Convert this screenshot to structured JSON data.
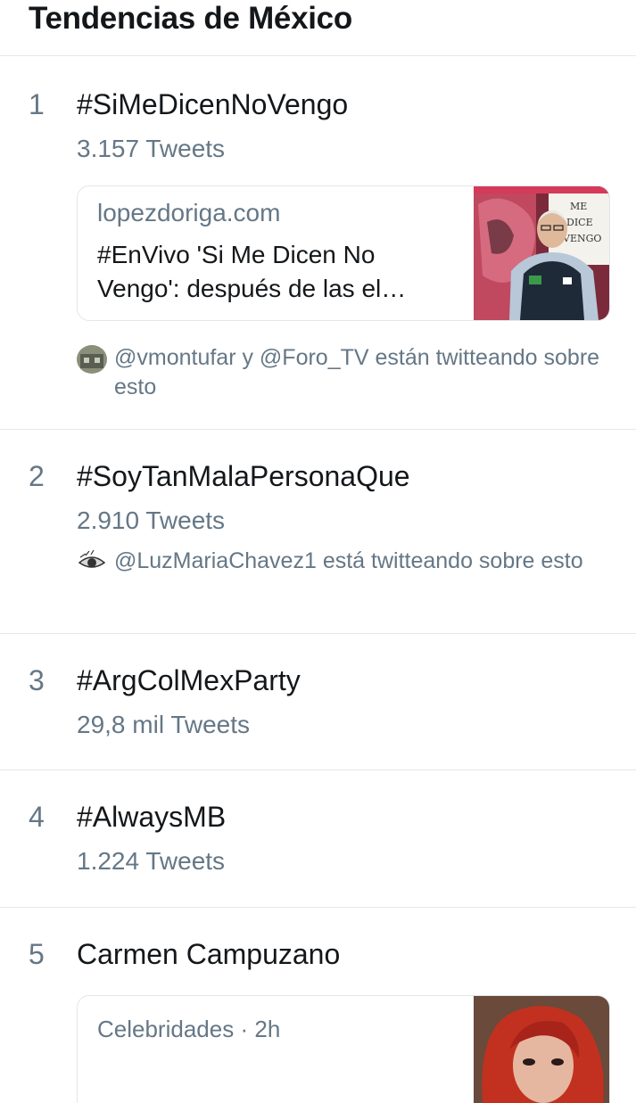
{
  "header": {
    "title": "Tendencias de México"
  },
  "trends": [
    {
      "rank": "1",
      "name": "#SiMeDicenNoVengo",
      "tweets": "3.157 Tweets",
      "card": {
        "domain": "lopezdoriga.com",
        "title": "#EnVivo 'Si Me Dicen No Vengo': después de las el…",
        "sign_text": [
          "ME",
          "DICE",
          "VENGO"
        ]
      },
      "context": "@vmontufar y @Foro_TV están twitteando sobre esto"
    },
    {
      "rank": "2",
      "name": "#SoyTanMalaPersonaQue",
      "tweets": "2.910 Tweets",
      "context": "@LuzMariaChavez1 está twitteando sobre esto"
    },
    {
      "rank": "3",
      "name": "#ArgColMexParty",
      "tweets": "29,8 mil Tweets"
    },
    {
      "rank": "4",
      "name": "#AlwaysMB",
      "tweets": "1.224 Tweets"
    },
    {
      "rank": "5",
      "name": "Carmen Campuzano",
      "card": {
        "category": "Celebridades",
        "separator": "·",
        "time": "2h"
      }
    }
  ],
  "colors": {
    "text": "#14171a",
    "secondary": "#657786",
    "border": "#e1e8ed"
  }
}
